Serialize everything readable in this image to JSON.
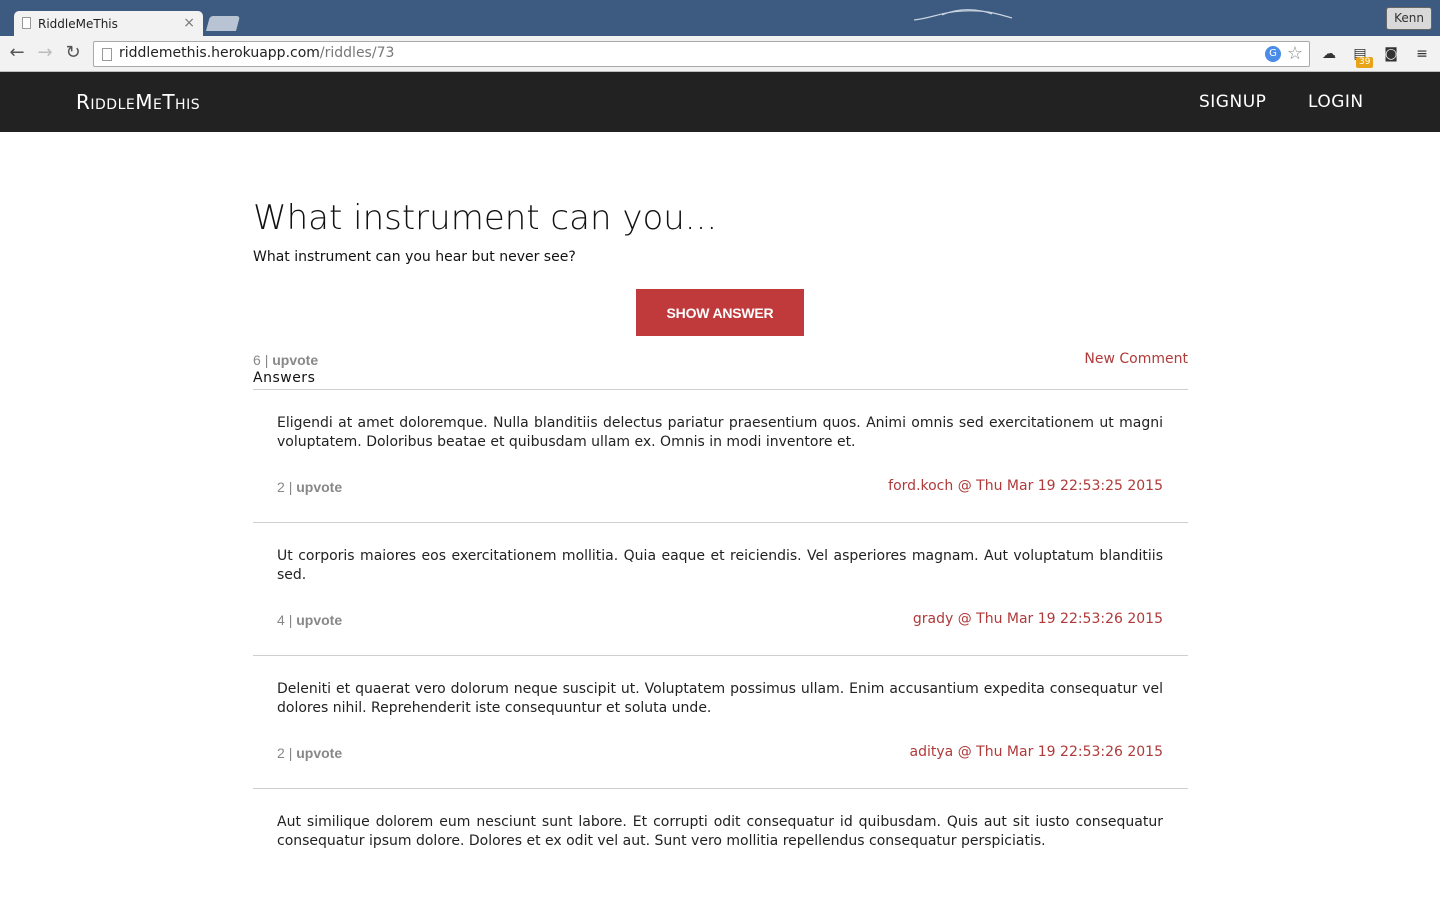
{
  "browser": {
    "tab_title": "RiddleMeThis",
    "url_host": "riddlemethis.herokuapp.com",
    "url_path": "/riddles/73",
    "profile_name": "Kenn",
    "extension_badge": "39"
  },
  "site": {
    "brand": "RiddleMeThis",
    "nav": {
      "signup": "SIGNUP",
      "login": "LOGIN"
    }
  },
  "riddle": {
    "title": "What instrument can you...",
    "question": "What instrument can you hear but never see?",
    "show_answer_label": "SHOW ANSWER",
    "vote_count": "6",
    "separator": "|",
    "upvote_label": "upvote",
    "new_comment_label": "New Comment",
    "answers_heading": "Answers"
  },
  "answers": [
    {
      "text": "Eligendi at amet doloremque. Nulla blanditiis delectus pariatur praesentium quos. Animi omnis sed exercitationem ut magni voluptatem. Doloribus beatae et quibusdam ullam ex. Omnis in modi inventore et.",
      "votes": "2",
      "upvote_label": "upvote",
      "meta": "ford.koch @ Thu Mar 19 22:53:25 2015"
    },
    {
      "text": "Ut corporis maiores eos exercitationem mollitia. Quia eaque et reiciendis. Vel asperiores magnam. Aut voluptatum blanditiis sed.",
      "votes": "4",
      "upvote_label": "upvote",
      "meta": "grady @ Thu Mar 19 22:53:26 2015"
    },
    {
      "text": "Deleniti et quaerat vero dolorum neque suscipit ut. Voluptatem possimus ullam. Enim accusantium expedita consequatur vel dolores nihil. Reprehenderit iste consequuntur et soluta unde.",
      "votes": "2",
      "upvote_label": "upvote",
      "meta": "aditya @ Thu Mar 19 22:53:26 2015"
    },
    {
      "text": "Aut similique dolorem eum nesciunt sunt labore. Et corrupti odit consequatur id quibusdam. Quis aut sit iusto consequatur consequatur ipsum dolore. Dolores et ex odit vel aut. Sunt vero mollitia repellendus consequatur perspiciatis."
    }
  ]
}
